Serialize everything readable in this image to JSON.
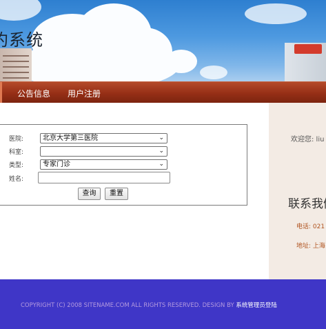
{
  "header": {
    "title": "约系统"
  },
  "nav": {
    "items": [
      {
        "label": "公告信息"
      },
      {
        "label": "用户注册"
      }
    ]
  },
  "form": {
    "hospital_label": "医院:",
    "hospital_value": "北京大学第三医院",
    "department_label": "科室:",
    "department_value": "",
    "type_label": "类型:",
    "type_value": "专家门诊",
    "name_label": "姓名:",
    "name_value": "",
    "query_button": "查询",
    "reset_button": "重置"
  },
  "sidebar": {
    "welcome": "欢迎您: liu",
    "contact_title": "联系我们",
    "phone": "电话: 021",
    "address": "地址: 上海"
  },
  "footer": {
    "copyright": "COPYRIGHT (C) 2008 SITENAME.COM  ALL RIGHTS RESERVED. DESIGN BY ",
    "admin_link": "系统管理员登陆"
  },
  "colors": {
    "nav": "#962f16",
    "footer": "#3f36c7",
    "sidebar": "#f3ebe4",
    "accent_text": "#b0531f"
  },
  "icons": {
    "select_arrow": "chevron-down-icon"
  }
}
